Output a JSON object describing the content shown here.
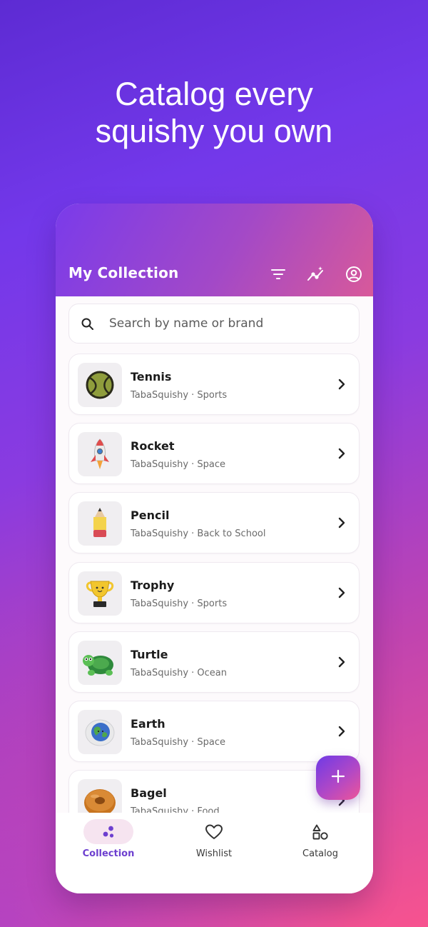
{
  "headline": {
    "line1": "Catalog every",
    "line2": "squishy you own"
  },
  "appbar": {
    "title": "My Collection",
    "icons": [
      "filter-icon",
      "trending-icon",
      "account-icon"
    ]
  },
  "search": {
    "placeholder": "Search by name or brand",
    "value": ""
  },
  "items": [
    {
      "name": "Tennis",
      "brand": "TabaSquishy",
      "category": "Sports",
      "subtitle": "TabaSquishy · Sports",
      "icon": "tennis-ball-thumbnail"
    },
    {
      "name": "Rocket",
      "brand": "TabaSquishy",
      "category": "Space",
      "subtitle": "TabaSquishy · Space",
      "icon": "rocket-thumbnail"
    },
    {
      "name": "Pencil",
      "brand": "TabaSquishy",
      "category": "Back to School",
      "subtitle": "TabaSquishy · Back to School",
      "icon": "pencil-thumbnail"
    },
    {
      "name": "Trophy",
      "brand": "TabaSquishy",
      "category": "Sports",
      "subtitle": "TabaSquishy · Sports",
      "icon": "trophy-thumbnail"
    },
    {
      "name": "Turtle",
      "brand": "TabaSquishy",
      "category": "Ocean",
      "subtitle": "TabaSquishy · Ocean",
      "icon": "turtle-thumbnail"
    },
    {
      "name": "Earth",
      "brand": "TabaSquishy",
      "category": "Space",
      "subtitle": "TabaSquishy · Space",
      "icon": "earth-thumbnail"
    },
    {
      "name": "Bagel",
      "brand": "TabaSquishy",
      "category": "Food",
      "subtitle": "TabaSquishy · Food",
      "icon": "bagel-thumbnail"
    }
  ],
  "fab": {
    "icon": "plus-icon"
  },
  "nav": {
    "items": [
      {
        "label": "Collection",
        "icon": "collection-icon",
        "active": true
      },
      {
        "label": "Wishlist",
        "icon": "heart-icon",
        "active": false
      },
      {
        "label": "Catalog",
        "icon": "shapes-icon",
        "active": false
      }
    ]
  },
  "colors": {
    "accent": "#6d3fcf",
    "appbar_start": "#7a3bea",
    "appbar_end": "#d8599a",
    "fab_start": "#6e3ae6",
    "fab_end": "#ee5598"
  }
}
